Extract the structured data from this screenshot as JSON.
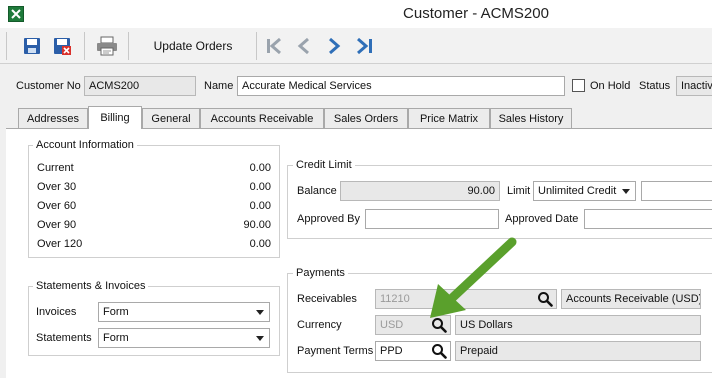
{
  "window": {
    "title": "Customer - ACMS200"
  },
  "toolbar": {
    "update_orders_label": "Update Orders"
  },
  "header": {
    "customer_no_label": "Customer No",
    "customer_no_value": "ACMS200",
    "name_label": "Name",
    "name_value": "Accurate Medical Services",
    "on_hold_label": "On Hold",
    "status_label": "Status",
    "status_value": "Inactiv"
  },
  "tabs": [
    {
      "label": "Addresses"
    },
    {
      "label": "Billing"
    },
    {
      "label": "General"
    },
    {
      "label": "Accounts Receivable"
    },
    {
      "label": "Sales Orders"
    },
    {
      "label": "Price Matrix"
    },
    {
      "label": "Sales History"
    }
  ],
  "active_tab": "Billing",
  "account_information": {
    "title": "Account Information",
    "rows": [
      {
        "label": "Current",
        "value": "0.00"
      },
      {
        "label": "Over 30",
        "value": "0.00"
      },
      {
        "label": "Over 60",
        "value": "0.00"
      },
      {
        "label": "Over 90",
        "value": "90.00"
      },
      {
        "label": "Over 120",
        "value": "0.00"
      }
    ]
  },
  "credit_limit": {
    "title": "Credit Limit",
    "balance_label": "Balance",
    "balance_value": "90.00",
    "limit_label": "Limit",
    "limit_value": "Unlimited Credit",
    "approved_by_label": "Approved By",
    "approved_by_value": "",
    "approved_date_label": "Approved Date",
    "approved_date_value": ""
  },
  "statements_invoices": {
    "title": "Statements & Invoices",
    "invoices_label": "Invoices",
    "invoices_value": "Form",
    "statements_label": "Statements",
    "statements_value": "Form"
  },
  "payments": {
    "title": "Payments",
    "receivables_label": "Receivables",
    "receivables_code": "11210",
    "receivables_desc": "Accounts Receivable (USD)",
    "currency_label": "Currency",
    "currency_code": "USD",
    "currency_desc": "US Dollars",
    "payment_terms_label": "Payment Terms",
    "payment_terms_code": "PPD",
    "payment_terms_desc": "Prepaid"
  },
  "colors": {
    "save_blue": "#2b5ea8",
    "nav_gray": "#9aa3ad",
    "nav_blue": "#2f6fb8",
    "arrow_green": "#5aa02c"
  },
  "icons": [
    "app-icon",
    "save-icon",
    "save-close-icon",
    "print-icon",
    "first-record-icon",
    "previous-record-icon",
    "next-record-icon",
    "last-record-icon",
    "search-icon",
    "annotation-arrow"
  ]
}
